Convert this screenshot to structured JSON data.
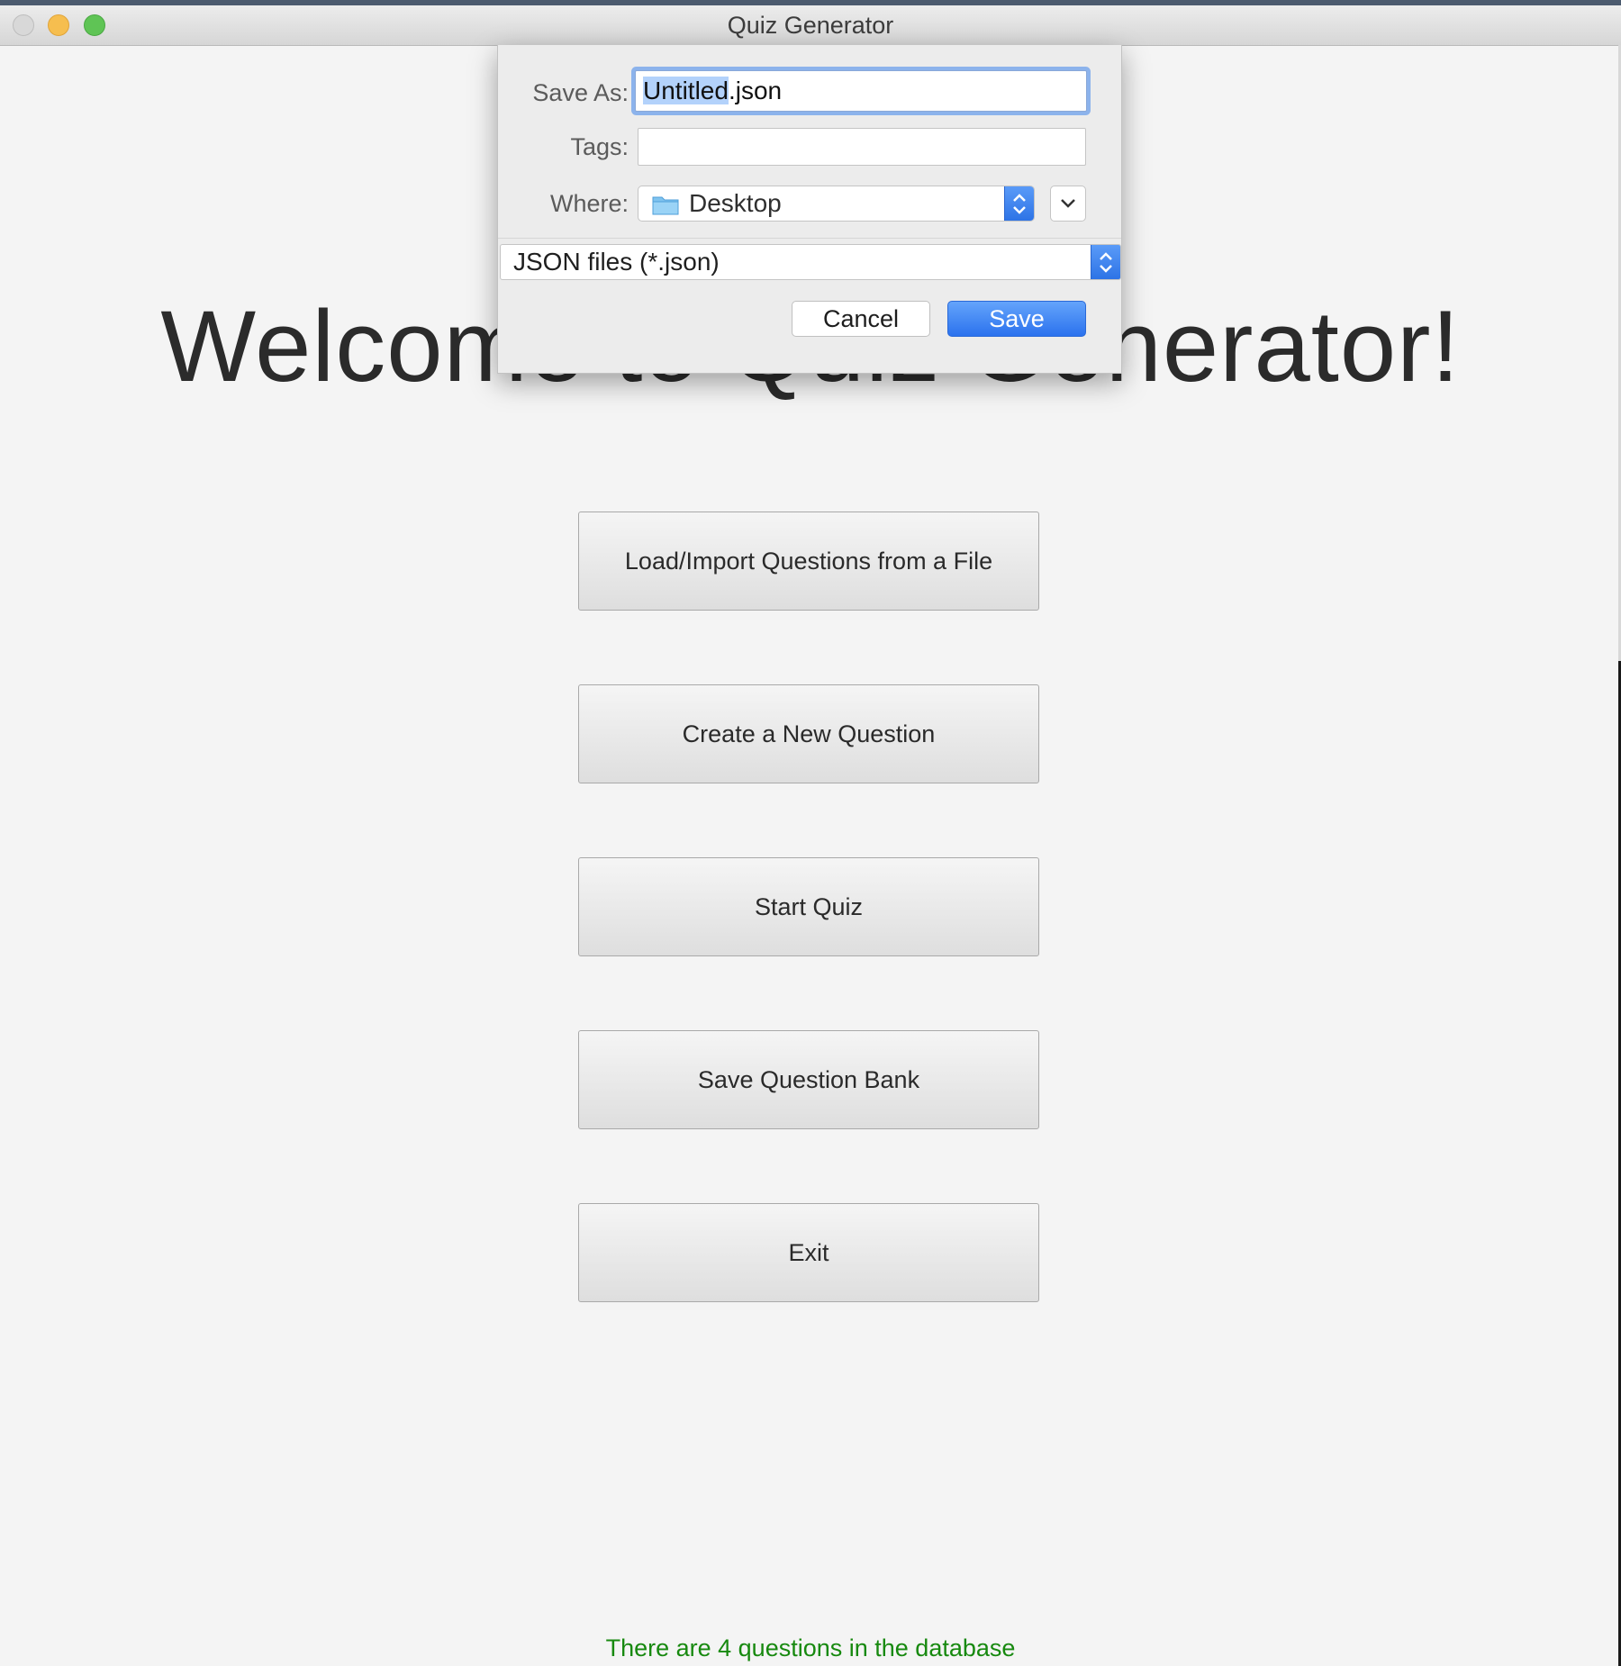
{
  "window": {
    "title": "Quiz Generator"
  },
  "main": {
    "welcome": "Welcome to Quiz Generator!",
    "buttons": {
      "load": "Load/Import Questions from a File",
      "create": "Create a New Question",
      "start": "Start Quiz",
      "save_bank": "Save Question Bank",
      "exit": "Exit"
    },
    "status": "There are 4 questions in the database",
    "status_color": "#17890f"
  },
  "save_dialog": {
    "save_as_label": "Save As:",
    "save_as_selected": "Untitled",
    "save_as_rest": ".json",
    "tags_label": "Tags:",
    "tags_value": "",
    "where_label": "Where:",
    "where_value": "Desktop",
    "where_icon": "folder-icon",
    "file_type": "JSON files (*.json)",
    "cancel_label": "Cancel",
    "save_label": "Save",
    "accent_color": "#2b72ee"
  }
}
